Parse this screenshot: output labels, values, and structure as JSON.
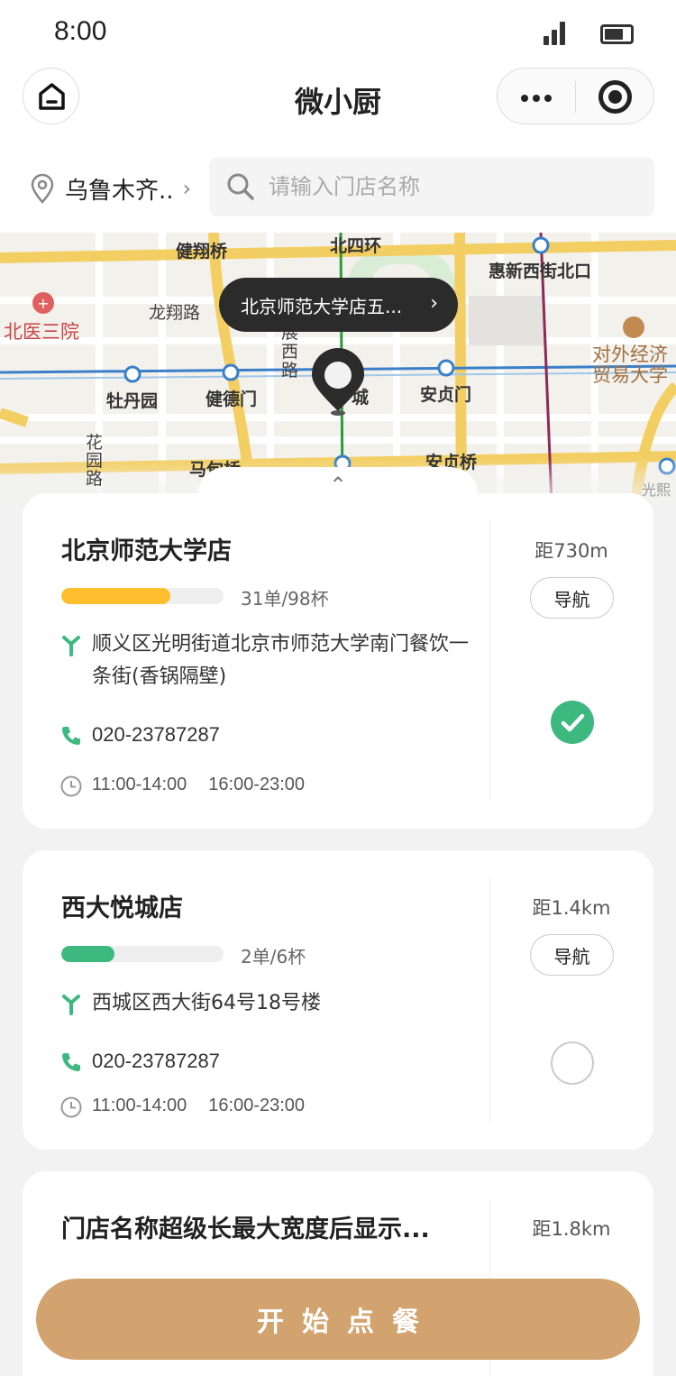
{
  "status_bar": {
    "time": "8:00"
  },
  "nav": {
    "title": "微小厨"
  },
  "location": {
    "city": "乌鲁木齐..",
    "search_placeholder": "请输入门店名称"
  },
  "map": {
    "labels": [
      "健翔桥",
      "北四环",
      "惠新西街北口",
      "龙翔路",
      "北医三院",
      "展",
      "西",
      "路",
      "对外经济",
      "贸易大学",
      "牡丹园",
      "健德门",
      "城",
      "安贞门",
      "花",
      "园",
      "路",
      "马甸桥",
      "安贞桥",
      "光熙"
    ],
    "popup": "北京师范大学店五..."
  },
  "colors": {
    "accent": "#d2a36e",
    "green": "#3db87f",
    "yellow": "#fdbf2d"
  },
  "stores": [
    {
      "name": "北京师范大学店",
      "distance": "距730m",
      "nav_label": "导航",
      "progress_text": "31单/98杯",
      "progress": 0.67,
      "address": "顺义区光明街道北京市师范大学南门餐饮一条街(香锅隔壁)",
      "phone": "020-23787287",
      "hours": [
        "11:00-14:00",
        "16:00-23:00"
      ],
      "selected": true
    },
    {
      "name": "西大悦城店",
      "distance": "距1.4km",
      "nav_label": "导航",
      "progress_text": "2单/6杯",
      "progress": 0.33,
      "address": "西城区西大街64号18号楼",
      "phone": "020-23787287",
      "hours": [
        "11:00-14:00",
        "16:00-23:00"
      ],
      "selected": false
    },
    {
      "name": "门店名称超级长最大宽度后显示...",
      "distance": "距1.8km"
    }
  ],
  "start_button": "开始点餐"
}
